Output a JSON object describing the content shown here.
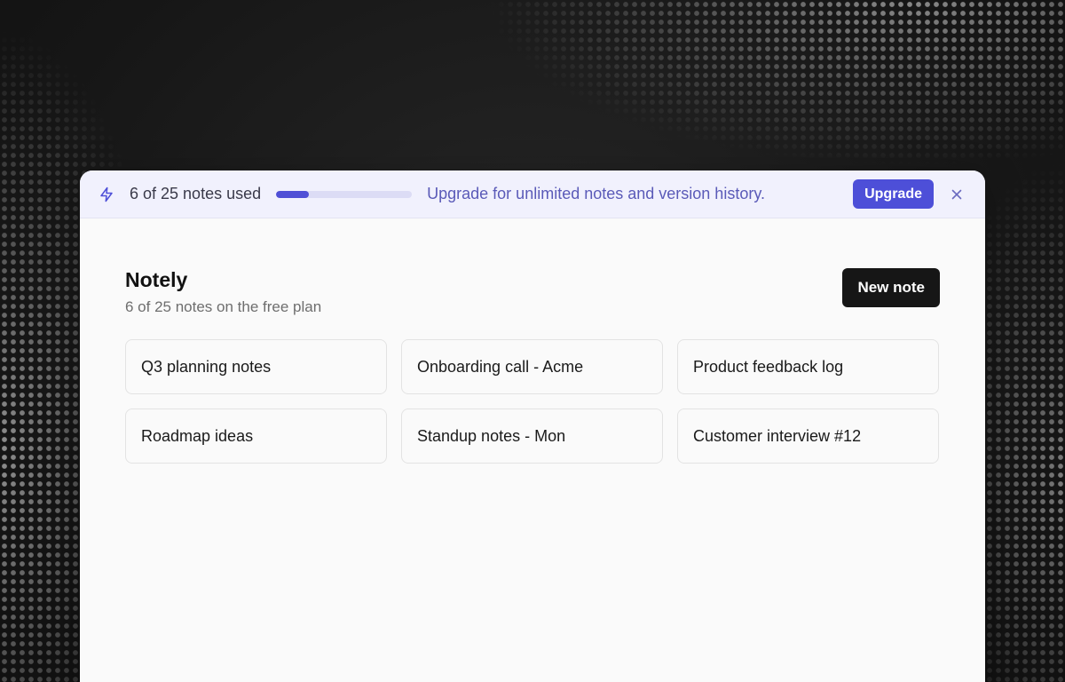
{
  "banner": {
    "usage_text": "6 of 25 notes used",
    "usage_used": 6,
    "usage_limit": 25,
    "message": "Upgrade for unlimited notes and version history.",
    "upgrade_label": "Upgrade",
    "icons": {
      "lead": "bolt-icon",
      "dismiss": "close-icon"
    }
  },
  "header": {
    "title": "Notely",
    "subtitle": "6 of 25 notes on the free plan",
    "new_note_label": "New note"
  },
  "notes": [
    {
      "title": "Q3 planning notes"
    },
    {
      "title": "Onboarding call - Acme"
    },
    {
      "title": "Product feedback log"
    },
    {
      "title": "Roadmap ideas"
    },
    {
      "title": "Standup notes - Mon"
    },
    {
      "title": "Customer interview #12"
    }
  ],
  "colors": {
    "accent": "#4d4fd8",
    "banner_bg": "#f1f1fd",
    "banner_text": "#5a5ab8",
    "primary_button": "#161616"
  }
}
